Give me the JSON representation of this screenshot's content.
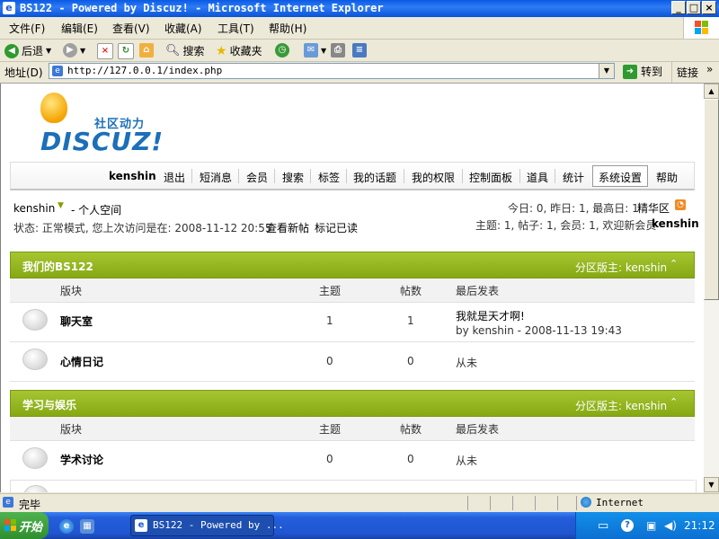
{
  "window": {
    "title": "BS122 - Powered by Discuz! - Microsoft Internet Explorer"
  },
  "menu": [
    "文件(F)",
    "编辑(E)",
    "查看(V)",
    "收藏(A)",
    "工具(T)",
    "帮助(H)"
  ],
  "toolbar": {
    "back": "后退",
    "search": "搜索",
    "favorites": "收藏夹"
  },
  "address": {
    "label": "地址(D)",
    "url": "http://127.0.0.1/index.php",
    "go": "转到",
    "links": "链接"
  },
  "logo": {
    "tagline": "社区动力",
    "brand": "DISCUZ!"
  },
  "nav": {
    "user": "kenshin",
    "items": [
      "退出",
      "短消息",
      "会员",
      "搜索",
      "标签",
      "我的话题",
      "我的权限",
      "控制面板",
      "道具",
      "统计",
      "系统设置",
      "帮助"
    ]
  },
  "userinfo": {
    "name": "kenshin",
    "space": "- 个人空间",
    "status": "状态: 正常模式, 您上次访问是在: 2008-11-12 20:55",
    "new_posts": "查看新帖",
    "mark_read": "标记已读",
    "today_stats": "今日: 0, 昨日: 1, 最高日: 1",
    "digest": "精华区",
    "totals": "主题: 1, 帖子: 1, 会员: 1, 欢迎新会员",
    "newest_member": "kenshin"
  },
  "columns": {
    "forum": "版块",
    "topics": "主题",
    "posts": "帖数",
    "last": "最后发表"
  },
  "categories": [
    {
      "name": "我们的BS122",
      "moderator": "分区版主: kenshin",
      "forums": [
        {
          "name": "聊天室",
          "topics": "1",
          "posts": "1",
          "last_title": "我就是天才啊!",
          "last_by": "by kenshin - 2008-11-13 19:43"
        },
        {
          "name": "心情日记",
          "topics": "0",
          "posts": "0",
          "last_title": "从未",
          "last_by": ""
        }
      ]
    },
    {
      "name": "学习与娱乐",
      "moderator": "分区版主: kenshin",
      "forums": [
        {
          "name": "学术讨论",
          "topics": "0",
          "posts": "0",
          "last_title": "从未",
          "last_by": ""
        }
      ]
    }
  ],
  "status": {
    "text": "完毕",
    "zone": "Internet"
  },
  "taskbar": {
    "start": "开始",
    "task": "BS122 - Powered by ...",
    "clock": "21:12"
  }
}
